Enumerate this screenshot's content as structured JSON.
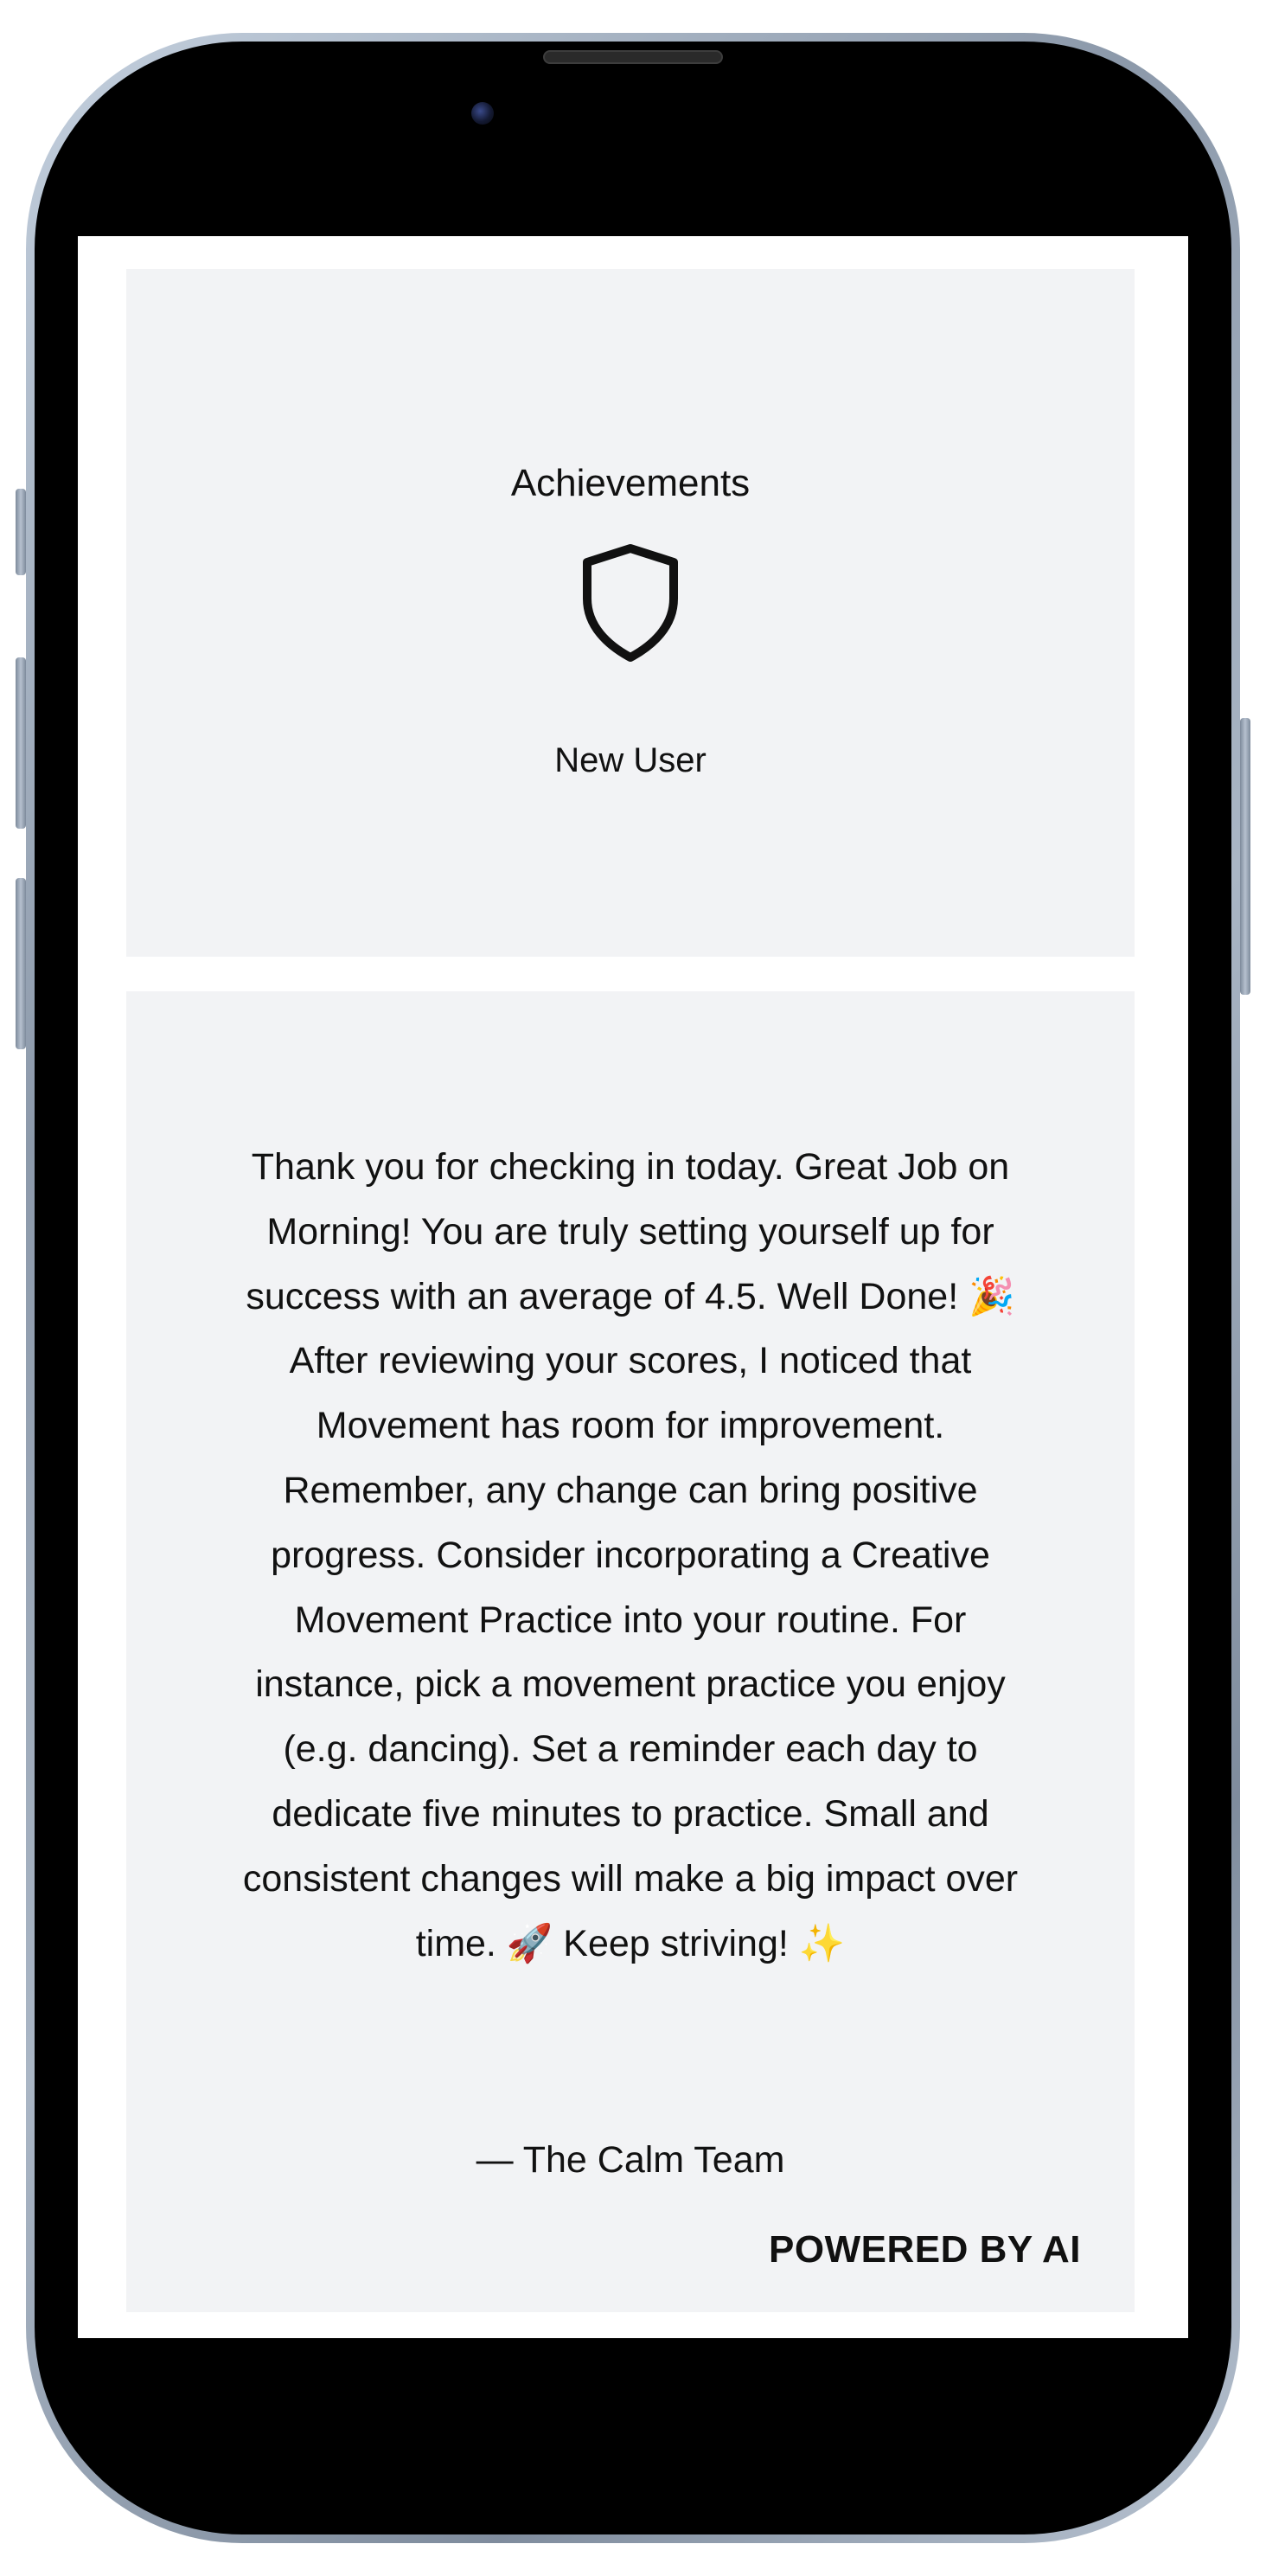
{
  "achievements": {
    "title": "Achievements",
    "badge_icon": "shield-icon",
    "badge_label": "New User"
  },
  "message": {
    "body": "Thank you for checking in today. Great Job on Morning! You are truly setting yourself up for success with an average of 4.5. Well Done! 🎉 After reviewing your scores, I noticed that Movement has room for improvement. Remember, any change can bring positive progress. Consider incorporating a Creative Movement Practice into your routine. For instance, pick a movement practice you enjoy (e.g. dancing). Set a reminder each day to dedicate five minutes to practice. Small and consistent changes will make a big impact over time. 🚀 Keep striving! ✨",
    "signature": "— The Calm Team",
    "powered_by": "POWERED BY AI"
  },
  "colors": {
    "card_background": "#f2f3f5",
    "text": "#111111",
    "screen_background": "#ffffff"
  }
}
